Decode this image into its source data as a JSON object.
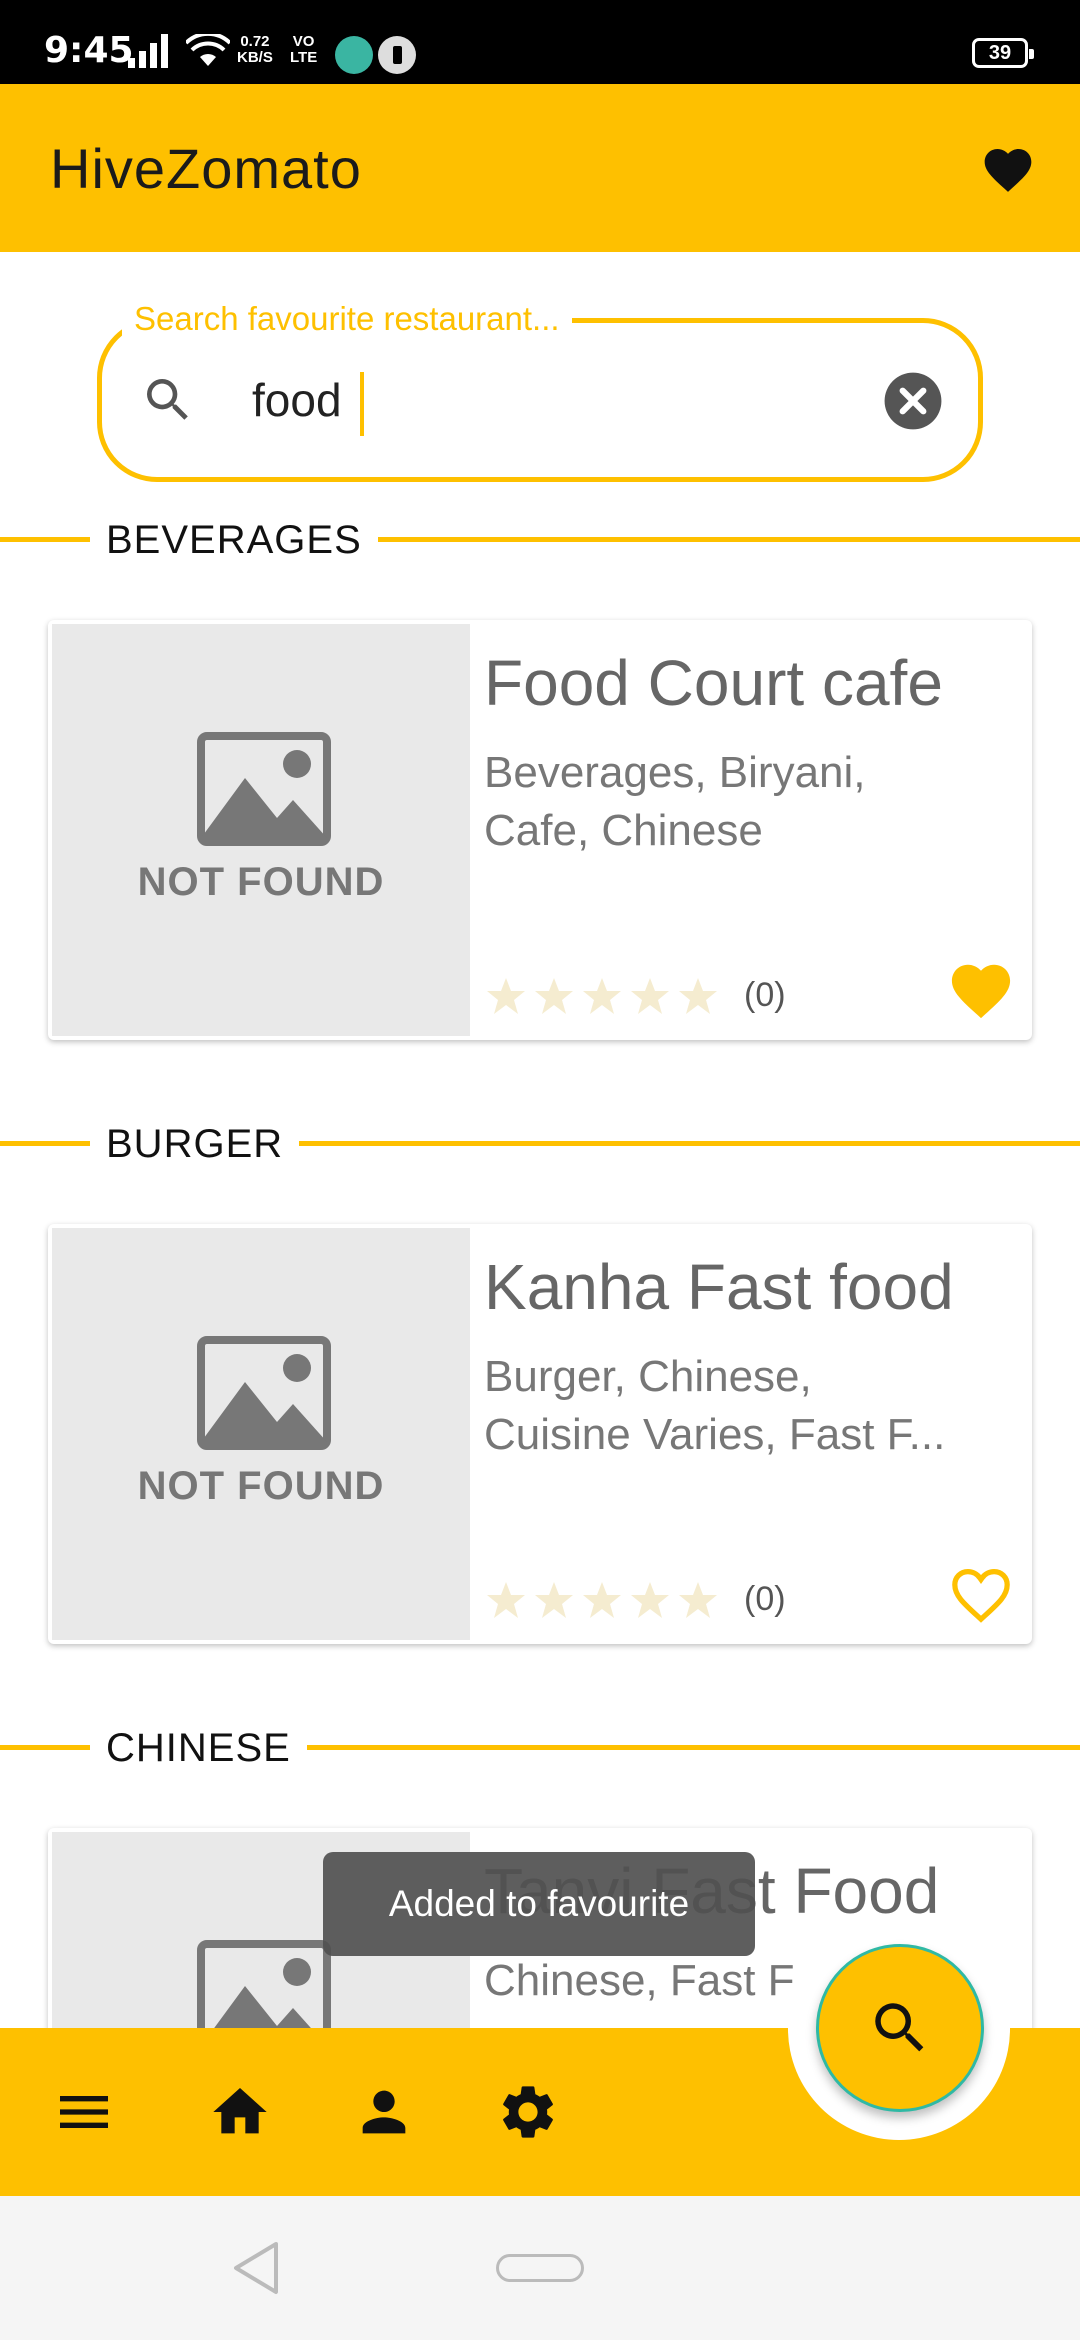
{
  "status_bar": {
    "time": "9:45",
    "speed_value": "0.72",
    "speed_unit": "KB/S",
    "volte_top": "VO",
    "volte_bottom": "LTE",
    "battery": "39"
  },
  "app_bar": {
    "title": "HiveZomato",
    "favorites_icon": "heart-icon"
  },
  "search": {
    "label": "Search favourite restaurant...",
    "value": "food",
    "search_icon": "search-icon",
    "clear_icon": "clear-icon"
  },
  "sections": [
    {
      "label": "BEVERAGES",
      "restaurant": {
        "name": "Food Court cafe",
        "cuisines_line1": "Beverages, Biryani,",
        "cuisines_line2": "Cafe, Chinese",
        "image_placeholder": "NOT FOUND",
        "rating": 0,
        "rating_count": "(0)",
        "favourite": true
      }
    },
    {
      "label": "BURGER",
      "restaurant": {
        "name": "Kanha Fast food",
        "cuisines_line1": "Burger, Chinese,",
        "cuisines_line2": "Cuisine Varies, Fast F...",
        "image_placeholder": "NOT FOUND",
        "rating": 0,
        "rating_count": "(0)",
        "favourite": false
      }
    },
    {
      "label": "CHINESE",
      "restaurant": {
        "name": "Tanvi Fast Food",
        "cuisines_line1": "Chinese, Fast F",
        "favourite": false
      }
    }
  ],
  "toast": "Added to favourite",
  "bottom_nav": {
    "items": [
      "menu-icon",
      "home-icon",
      "person-icon",
      "settings-icon"
    ],
    "fab_icon": "search-icon"
  },
  "colors": {
    "accent": "#fec000",
    "fab_border": "#2fb9a4",
    "star_empty": "#f5ecd0"
  }
}
